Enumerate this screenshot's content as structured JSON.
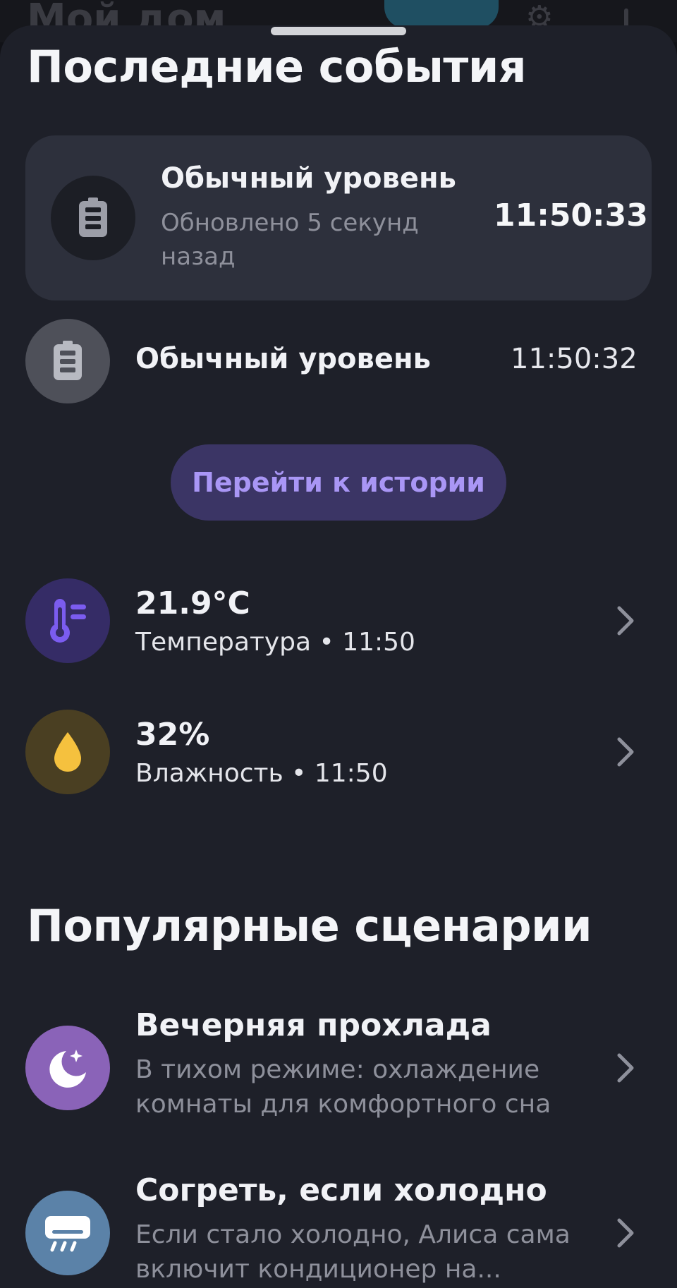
{
  "background_screen": {
    "title": "Мой дом"
  },
  "events_section": {
    "title": "Последние события",
    "latest": {
      "title": "Обычный уровень",
      "subtitle": "Обновлено 5 секунд назад",
      "time": "11:50:33",
      "icon": "battery-icon"
    },
    "previous": {
      "title": "Обычный уровень",
      "time": "11:50:32",
      "icon": "battery-icon"
    },
    "history_button": "Перейти к истории"
  },
  "sensors": [
    {
      "value": "21.9°C",
      "meta": "Температура • 11:50",
      "icon": "thermometer-icon",
      "color": "#7b5cf0"
    },
    {
      "value": "32%",
      "meta": "Влажность • 11:50",
      "icon": "water-drop-icon",
      "color": "#f5c13e"
    }
  ],
  "scenarios_section": {
    "title": "Популярные сценарии",
    "items": [
      {
        "title": "Вечерняя прохлада",
        "desc": "В тихом режиме: охлаждение комнаты для комфортного сна",
        "icon": "moon-star-icon",
        "color": "#8a63b8"
      },
      {
        "title": "Согреть, если холодно",
        "desc": "Если стало холодно, Алиса сама включит кондиционер на...",
        "icon": "air-conditioner-icon",
        "color": "#5b82a8"
      }
    ]
  },
  "colors": {
    "sheet_bg": "#1e2029",
    "card_bg": "#2d303c",
    "accent": "#a996f5",
    "button_bg": "#3b3565"
  }
}
